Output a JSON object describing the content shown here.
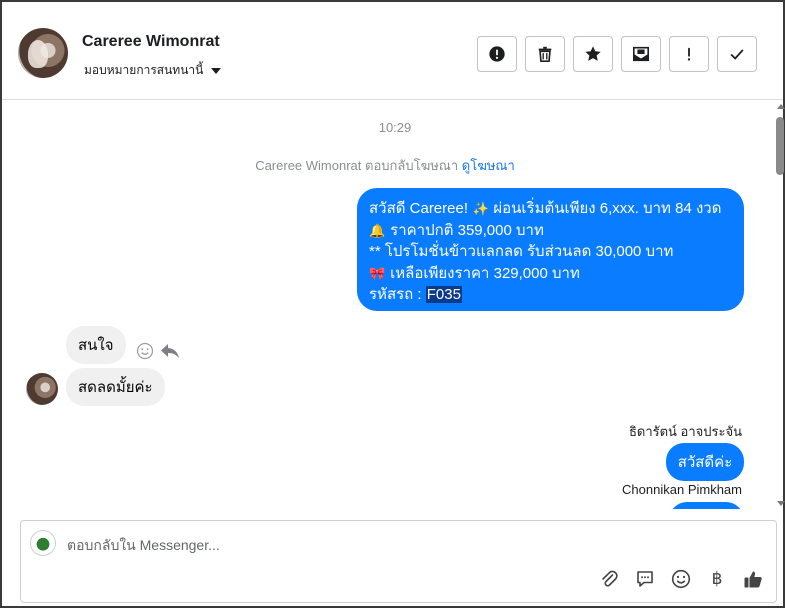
{
  "header": {
    "contact_name": "Careree Wimonrat",
    "assign_label": "มอบหมายการสนทนานี้",
    "actions": [
      {
        "name": "report-spam-button",
        "icon": "alert-circle-icon"
      },
      {
        "name": "delete-button",
        "icon": "trash-icon"
      },
      {
        "name": "star-button",
        "icon": "star-icon"
      },
      {
        "name": "mark-unread-button",
        "icon": "envelope-icon"
      },
      {
        "name": "flag-button",
        "icon": "exclamation-icon"
      },
      {
        "name": "mark-done-button",
        "icon": "check-icon"
      }
    ]
  },
  "conversation": {
    "timestamp": "10:29",
    "ad_note_text": "Careree Wimonrat ตอบกลับโฆษณา",
    "ad_note_link": "ดูโฆษณา",
    "promo_lines": {
      "l1_text": "สวัสดี Careree! ",
      "l1_emoji": "✨",
      "l1_text2": "  ผ่อนเริ่มต้นเพียง 6,xxx. บาท 84 งวด",
      "l2_emoji": "🔔",
      "l2_text": " ราคาปกติ  359,000 บาท",
      "l3_text": "** โปรโมชั่นข้าวแลกลด รับส่วนลด 30,000 บาท",
      "l4_emoji": "🎀",
      "l4_text": "  เหลือเพียงราคา 329,000 บาท",
      "l5_label": " รหัสรถ : ",
      "l5_code": "F035"
    },
    "incoming_1": "สนใจ",
    "incoming_2": "สดลดมั้ยค่ะ",
    "agent_1_name": "ธิดารัตน์ อาจประจัน",
    "outgoing_hello": "สวัสดีค่ะ",
    "agent_2_name": "Chonnikan Pimkham"
  },
  "composer": {
    "placeholder": "ตอบกลับใน Messenger...",
    "tools": [
      "paperclip-icon",
      "chat-bubble-icon",
      "emoji-icon",
      "baht-icon",
      "thumbs-up-icon"
    ],
    "baht_symbol": "฿"
  },
  "colors": {
    "outgoing_bubble": "#0a7cff",
    "incoming_bubble": "#f0f0f0",
    "link": "#1877f2"
  }
}
